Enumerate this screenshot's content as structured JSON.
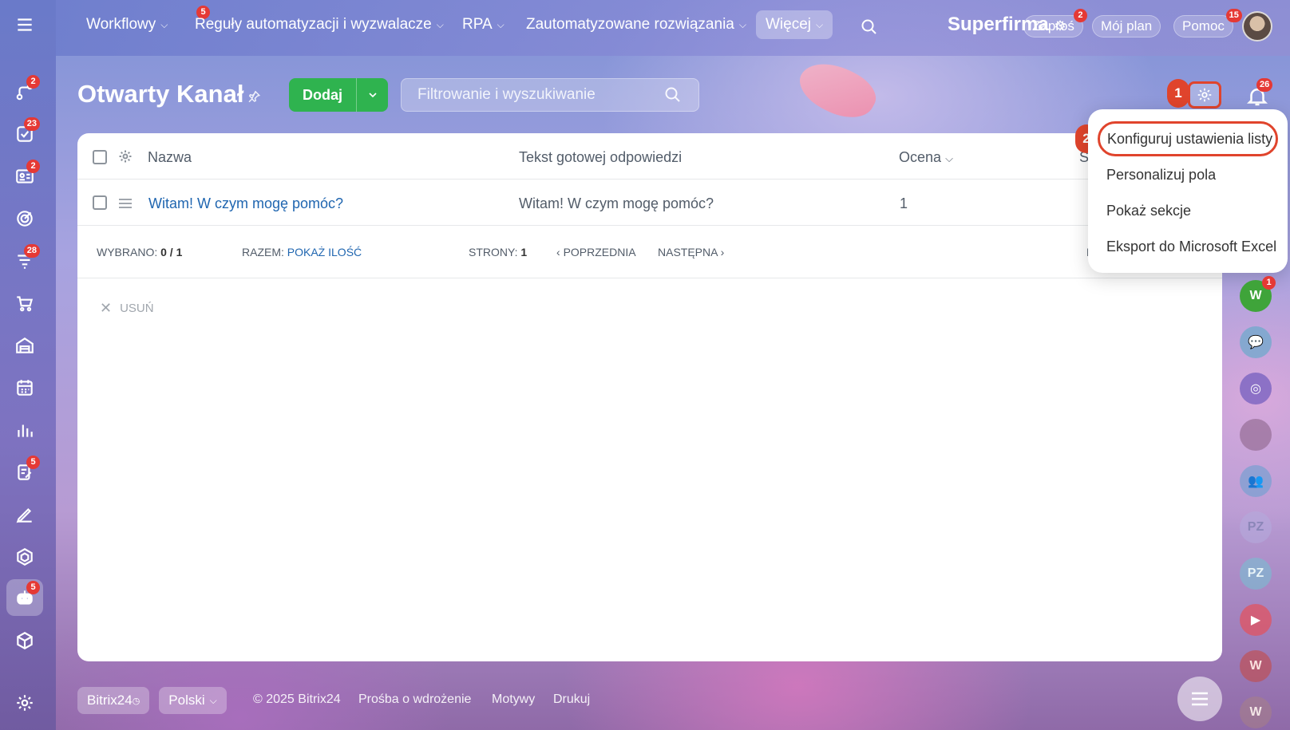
{
  "topnav": {
    "items": [
      {
        "label": "Workflowy",
        "badge": "5"
      },
      {
        "label": "Reguły automatyzacji i wyzwalacze"
      },
      {
        "label": "RPA"
      },
      {
        "label": "Zautomatyzowane rozwiązania"
      },
      {
        "label": "Więcej"
      }
    ],
    "brand": "Superfirma",
    "invite_label": "Zaproś",
    "invite_badge": "2",
    "plan_label": "Mój plan",
    "help_label": "Pomoc",
    "help_badge": "15"
  },
  "sidebar": {
    "badges": {
      "automation": "2",
      "tasks": "23",
      "crm": "2",
      "funnels": "28",
      "sign": "5",
      "bot": "5"
    }
  },
  "page": {
    "title": "Otwarty Kanał",
    "add_label": "Dodaj",
    "search_placeholder": "Filtrowanie i wyszukiwanie",
    "notification_badge": "26",
    "step1": "1",
    "step2": "2"
  },
  "table": {
    "columns": [
      "Nazwa",
      "Tekst gotowej odpowiedzi",
      "Ocena",
      "S"
    ],
    "rows": [
      {
        "name": "Witam! W czym mogę pomóc?",
        "text": "Witam! W czym mogę pomóc?",
        "rating": "1"
      }
    ],
    "footer": {
      "selected_label": "WYBRANO:",
      "selected_value": "0 / 1",
      "total_label": "RAZEM:",
      "total_link": "POKAŻ ILOŚĆ",
      "pages_label": "STRONY:",
      "pages_value": "1",
      "prev_label": "POPRZEDNIA",
      "next_label": "NASTĘPNA",
      "right_clip": "P"
    },
    "delete_label": "USUŃ"
  },
  "menu": {
    "items": [
      "Konfiguruj ustawienia listy",
      "Personalizuj pola",
      "Pokaż sekcje",
      "Eksport do Microsoft Excel"
    ]
  },
  "rightrail": {
    "w_badge": "1",
    "w_label": "W",
    "pz_label": "PZ"
  },
  "footer": {
    "logo": "Bitrix24",
    "language": "Polski",
    "copyright": "© 2025 Bitrix24",
    "links": [
      "Prośba o wdrożenie",
      "Motywy",
      "Drukuj"
    ]
  },
  "colors": {
    "accent_green": "#2fb34f",
    "highlight_red": "#e0442c",
    "link_blue": "#2066b0",
    "badge_red": "#e53935"
  }
}
